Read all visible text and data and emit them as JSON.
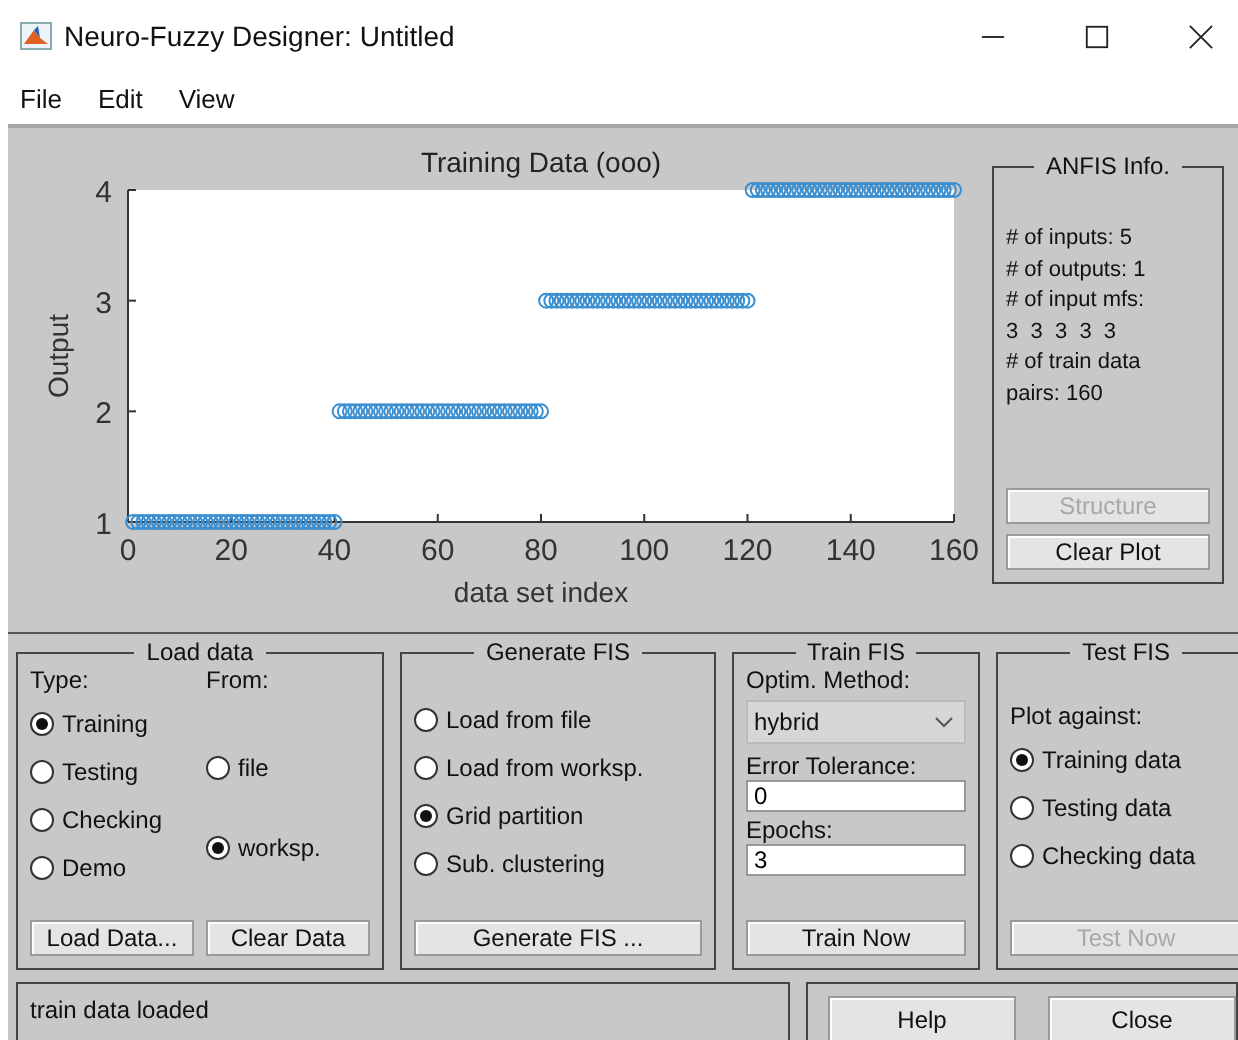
{
  "window": {
    "title": "Neuro-Fuzzy Designer: Untitled"
  },
  "menu": [
    "File",
    "Edit",
    "View"
  ],
  "plot": {
    "chart_data": {
      "type": "scatter",
      "title": "Training Data (ooo)",
      "xlabel": "data set index",
      "ylabel": "Output",
      "x": [
        1,
        2,
        3,
        4,
        5,
        6,
        7,
        8,
        9,
        10,
        11,
        12,
        13,
        14,
        15,
        16,
        17,
        18,
        19,
        20,
        21,
        22,
        23,
        24,
        25,
        26,
        27,
        28,
        29,
        30,
        31,
        32,
        33,
        34,
        35,
        36,
        37,
        38,
        39,
        40,
        41,
        42,
        43,
        44,
        45,
        46,
        47,
        48,
        49,
        50,
        51,
        52,
        53,
        54,
        55,
        56,
        57,
        58,
        59,
        60,
        61,
        62,
        63,
        64,
        65,
        66,
        67,
        68,
        69,
        70,
        71,
        72,
        73,
        74,
        75,
        76,
        77,
        78,
        79,
        80,
        81,
        82,
        83,
        84,
        85,
        86,
        87,
        88,
        89,
        90,
        91,
        92,
        93,
        94,
        95,
        96,
        97,
        98,
        99,
        100,
        101,
        102,
        103,
        104,
        105,
        106,
        107,
        108,
        109,
        110,
        111,
        112,
        113,
        114,
        115,
        116,
        117,
        118,
        119,
        120,
        121,
        122,
        123,
        124,
        125,
        126,
        127,
        128,
        129,
        130,
        131,
        132,
        133,
        134,
        135,
        136,
        137,
        138,
        139,
        140,
        141,
        142,
        143,
        144,
        145,
        146,
        147,
        148,
        149,
        150,
        151,
        152,
        153,
        154,
        155,
        156,
        157,
        158,
        159,
        160
      ],
      "series": [
        {
          "color": "#3a8fd0",
          "values": [
            1,
            1,
            1,
            1,
            1,
            1,
            1,
            1,
            1,
            1,
            1,
            1,
            1,
            1,
            1,
            1,
            1,
            1,
            1,
            1,
            1,
            1,
            1,
            1,
            1,
            1,
            1,
            1,
            1,
            1,
            1,
            1,
            1,
            1,
            1,
            1,
            1,
            1,
            1,
            1,
            2,
            2,
            2,
            2,
            2,
            2,
            2,
            2,
            2,
            2,
            2,
            2,
            2,
            2,
            2,
            2,
            2,
            2,
            2,
            2,
            2,
            2,
            2,
            2,
            2,
            2,
            2,
            2,
            2,
            2,
            2,
            2,
            2,
            2,
            2,
            2,
            2,
            2,
            2,
            2,
            3,
            3,
            3,
            3,
            3,
            3,
            3,
            3,
            3,
            3,
            3,
            3,
            3,
            3,
            3,
            3,
            3,
            3,
            3,
            3,
            3,
            3,
            3,
            3,
            3,
            3,
            3,
            3,
            3,
            3,
            3,
            3,
            3,
            3,
            3,
            3,
            3,
            3,
            3,
            3,
            4,
            4,
            4,
            4,
            4,
            4,
            4,
            4,
            4,
            4,
            4,
            4,
            4,
            4,
            4,
            4,
            4,
            4,
            4,
            4,
            4,
            4,
            4,
            4,
            4,
            4,
            4,
            4,
            4,
            4,
            4,
            4,
            4,
            4,
            4,
            4,
            4,
            4,
            4,
            4
          ]
        }
      ],
      "xlim": [
        0,
        160
      ],
      "ylim": [
        1,
        4
      ],
      "xticks": [
        0,
        20,
        40,
        60,
        80,
        100,
        120,
        140,
        160
      ],
      "yticks": [
        1,
        2,
        3,
        4
      ]
    }
  },
  "anfis_info": {
    "title": "ANFIS Info.",
    "lines": [
      "# of inputs: 5",
      "# of outputs: 1",
      "# of input mfs:",
      "3  3  3  3  3",
      "# of train data",
      "pairs: 160"
    ],
    "buttons": [
      {
        "label": "Structure",
        "disabled": true
      },
      {
        "label": "Clear Plot",
        "disabled": false
      }
    ]
  },
  "load_data": {
    "title": "Load data",
    "type_label": "Type:",
    "from_label": "From:",
    "types": [
      {
        "label": "Training",
        "selected": true
      },
      {
        "label": "Testing",
        "selected": false
      },
      {
        "label": "Checking",
        "selected": false
      },
      {
        "label": "Demo",
        "selected": false
      }
    ],
    "sources": [
      {
        "label": "file",
        "selected": false
      },
      {
        "label": "worksp.",
        "selected": true
      }
    ],
    "buttons": [
      "Load Data...",
      "Clear Data"
    ]
  },
  "generate_fis": {
    "title": "Generate FIS",
    "options": [
      {
        "label": "Load from file",
        "selected": false
      },
      {
        "label": "Load from worksp.",
        "selected": false
      },
      {
        "label": "Grid partition",
        "selected": true
      },
      {
        "label": "Sub. clustering",
        "selected": false
      }
    ],
    "button": "Generate FIS ..."
  },
  "train_fis": {
    "title": "Train FIS",
    "method_label": "Optim. Method:",
    "method": "hybrid",
    "tolerance_label": "Error Tolerance:",
    "tolerance": "0",
    "epochs_label": "Epochs:",
    "epochs": "3",
    "button": "Train Now"
  },
  "test_fis": {
    "title": "Test FIS",
    "plot_label": "Plot against:",
    "options": [
      {
        "label": "Training data",
        "selected": true
      },
      {
        "label": "Testing data",
        "selected": false
      },
      {
        "label": "Checking data",
        "selected": false
      }
    ],
    "button": {
      "label": "Test Now",
      "disabled": true
    }
  },
  "status": "train data loaded",
  "buttons": [
    "Help",
    "Close"
  ]
}
